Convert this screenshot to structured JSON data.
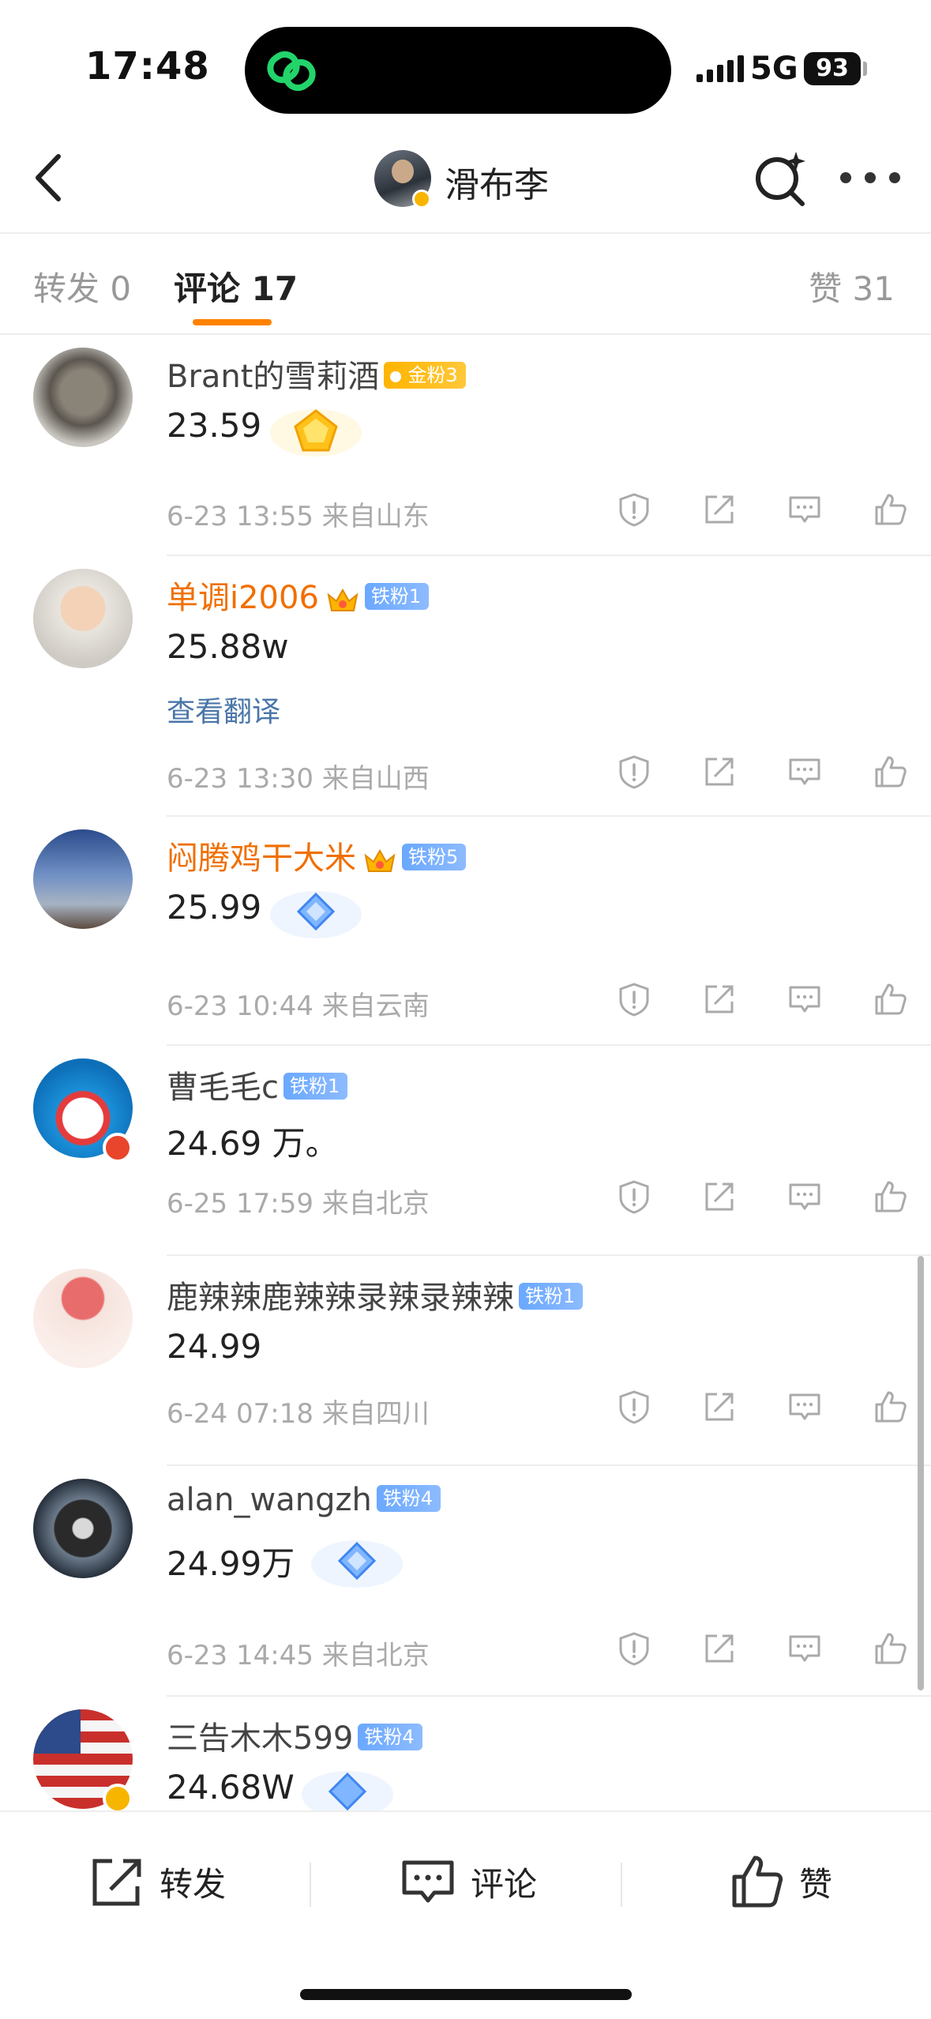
{
  "status_bar": {
    "time": "17:48",
    "network": "5G",
    "battery": "93"
  },
  "nav": {
    "title": "滑布李"
  },
  "tabs": {
    "repost": "转发 0",
    "comment": "评论 17",
    "like": "赞 31"
  },
  "comments": [
    {
      "user": "Brant的雪莉酒",
      "fan_badge": "金粉3",
      "text": "23.59",
      "translate": "",
      "meta": "6-23 13:55 来自山东"
    },
    {
      "user": "单调i2006",
      "fan_badge": "铁粉1",
      "text": "25.88w",
      "translate": "查看翻译",
      "meta": "6-23 13:30 来自山西"
    },
    {
      "user": "闷腾鸡干大米",
      "fan_badge": "铁粉5",
      "text": "25.99",
      "translate": "",
      "meta": "6-23 10:44 来自云南"
    },
    {
      "user": "曹毛毛c",
      "fan_badge": "铁粉1",
      "text": "24.69 万。",
      "translate": "",
      "meta": "6-25 17:59 来自北京"
    },
    {
      "user": "鹿辣辣鹿辣辣录辣录辣辣",
      "fan_badge": "铁粉1",
      "text": "24.99",
      "translate": "",
      "meta": "6-24 07:18 来自四川"
    },
    {
      "user": "alan_wangzh",
      "fan_badge": "铁粉4",
      "text": "24.99万",
      "translate": "",
      "meta": "6-23 14:45 来自北京"
    },
    {
      "user": "三告木木599",
      "fan_badge": "铁粉4",
      "text": "24.68W",
      "translate": "",
      "meta": ""
    }
  ],
  "bottom_bar": {
    "repost": "转发",
    "comment": "评论",
    "like": "赞"
  },
  "colors": {
    "accent": "#ff8200",
    "username_highlight": "#f06f00",
    "link": "#4a76a8",
    "gold_badge": "#ffb400",
    "iron_badge": "#6aa8ff"
  }
}
